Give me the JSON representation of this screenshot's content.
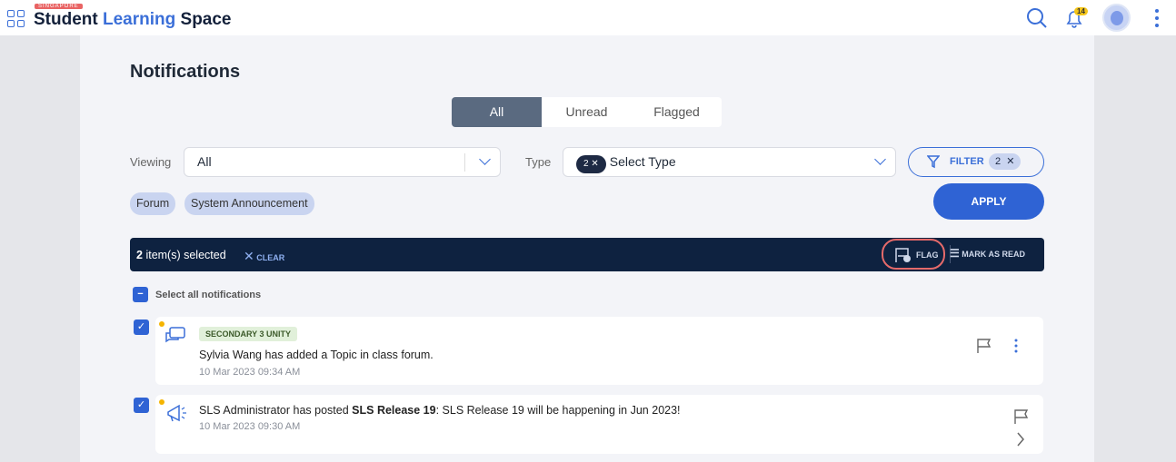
{
  "header": {
    "logo_tag": "SINGAPORE",
    "logo_part1": "Student",
    "logo_part2": "Learning",
    "logo_part3": "Space",
    "notif_count": "14"
  },
  "page": {
    "title": "Notifications"
  },
  "tabs": [
    {
      "label": "All"
    },
    {
      "label": "Unread"
    },
    {
      "label": "Flagged"
    }
  ],
  "filters": {
    "viewing_label": "Viewing",
    "viewing_value": "All",
    "type_label": "Type",
    "type_count": "2",
    "type_placeholder": "Select Type",
    "filter_label": "FILTER",
    "filter_count": "2",
    "apply_label": "APPLY",
    "chips": [
      "Forum",
      "System Announcement"
    ]
  },
  "selection": {
    "count": "2",
    "text": "item(s) selected",
    "clear": "CLEAR",
    "flag": "FLAG",
    "mark_read": "MARK AS READ",
    "select_all": "Select all notifications"
  },
  "notifications": [
    {
      "tag": "SECONDARY 3 UNITY",
      "message": "Sylvia Wang has added a Topic in class forum.",
      "time": "10 Mar 2023 09:34 AM"
    },
    {
      "msg_pre": "SLS Administrator has posted ",
      "msg_bold": "SLS Release 19",
      "msg_post": ": SLS Release 19 will be happening in Jun 2023!",
      "time": "10 Mar 2023 09:30 AM"
    }
  ],
  "colors": {
    "accent": "#2f63d4",
    "bar": "#0e2240",
    "unread": "#f5b400"
  }
}
